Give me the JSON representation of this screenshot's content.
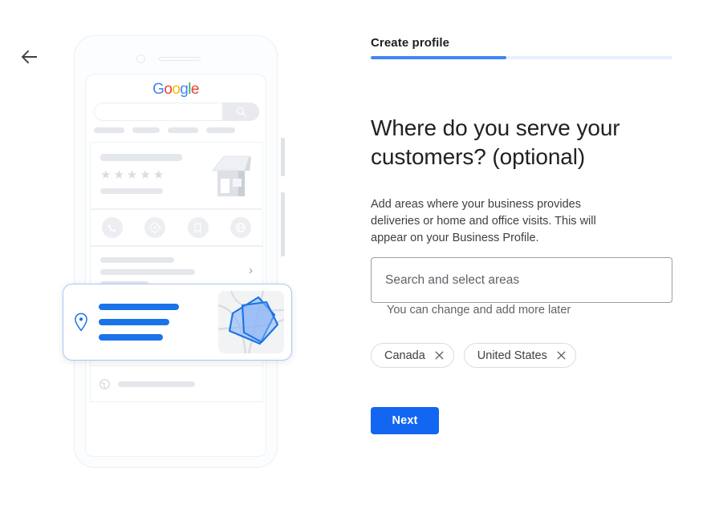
{
  "nav": {
    "back_icon": "arrow-left-icon"
  },
  "illustration": {
    "phone_mock": {
      "brand_logo": {
        "letters": [
          {
            "char": "G",
            "color": "#4285F4"
          },
          {
            "char": "o",
            "color": "#EA4335"
          },
          {
            "char": "o",
            "color": "#FBBC05"
          },
          {
            "char": "g",
            "color": "#4285F4"
          },
          {
            "char": "l",
            "color": "#34A853"
          },
          {
            "char": "e",
            "color": "#EA4335"
          }
        ]
      },
      "search_icon": "search-icon",
      "filter_chip_widths": [
        38,
        34,
        38,
        36
      ],
      "listing_card": {
        "rating_stars": 5,
        "star_glyph": "★",
        "storefront_icon": "storefront-icon"
      },
      "action_icons": [
        "phone-icon",
        "directions-icon",
        "bookmark-icon",
        "website-icon"
      ],
      "chevron_icon": "chevron-right-icon",
      "list_rows": [
        {
          "icon": "clock-icon"
        },
        {
          "icon": "phone-icon"
        },
        {
          "icon": "globe-icon"
        }
      ]
    },
    "service_area_card": {
      "pin_icon": "map-pin-icon",
      "line_widths": [
        100,
        88,
        80
      ],
      "accent_color": "#1a73e8",
      "map_thumbnail": {
        "polygon_fill": "#8ab4f8",
        "polygon_stroke": "#1a73e8"
      }
    }
  },
  "panel": {
    "step_label": "Create profile",
    "progress": {
      "percent": 45,
      "fill_color": "#4285f4",
      "track_color": "#e8f0fe"
    },
    "headline": "Where do you serve your customers? (optional)",
    "subtext": "Add areas where your business provides deliveries or home and office visits. This will appear on your Business Profile.",
    "search_field": {
      "value": "",
      "placeholder": "Search and select areas"
    },
    "helper_text": "You can change and add more later",
    "selected_areas": [
      {
        "label": "Canada",
        "remove_icon": "close-icon"
      },
      {
        "label": "United States",
        "remove_icon": "close-icon"
      }
    ],
    "primary_button": {
      "label": "Next",
      "color": "#1266f1"
    }
  }
}
